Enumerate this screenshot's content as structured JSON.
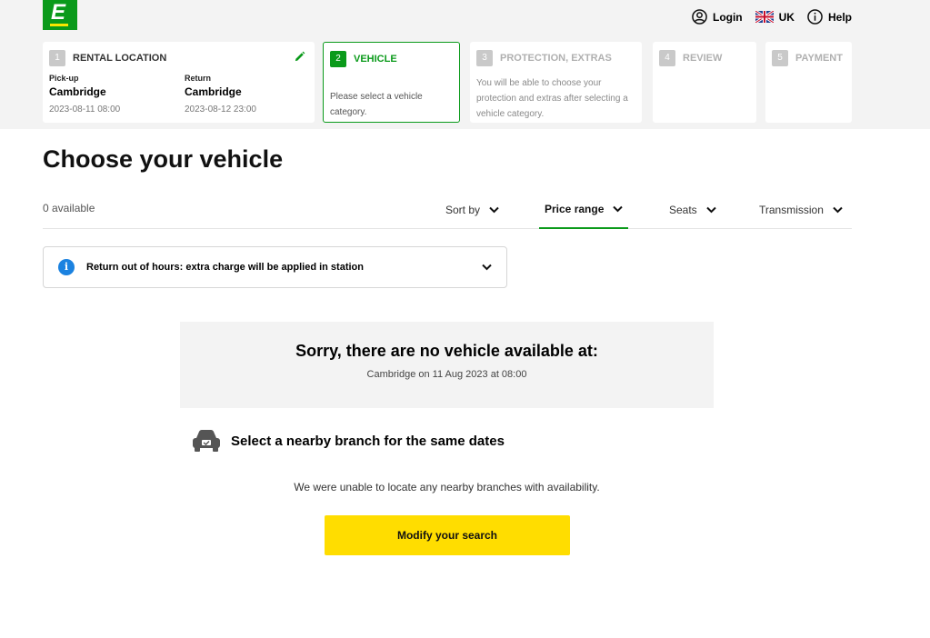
{
  "header": {
    "logo_letter": "E",
    "brand_color": "#0a9a1a",
    "accent_color": "#ffdd00",
    "login_label": "Login",
    "country_label": "UK",
    "help_label": "Help"
  },
  "steps": [
    {
      "number": "1",
      "title": "RENTAL LOCATION",
      "pickup": {
        "label": "Pick-up",
        "city": "Cambridge",
        "datetime": "2023-08-11 08:00"
      },
      "return": {
        "label": "Return",
        "city": "Cambridge",
        "datetime": "2023-08-12 23:00"
      }
    },
    {
      "number": "2",
      "title": "VEHICLE",
      "description": "Please select a vehicle category."
    },
    {
      "number": "3",
      "title": "PROTECTION, EXTRAS",
      "description": "You will be able to choose your protection and extras after selecting a vehicle category."
    },
    {
      "number": "4",
      "title": "REVIEW"
    },
    {
      "number": "5",
      "title": "PAYMENT"
    }
  ],
  "main": {
    "title": "Choose your vehicle",
    "available_text": "0 available",
    "filters": [
      {
        "label": "Sort by"
      },
      {
        "label": "Price range"
      },
      {
        "label": "Seats"
      },
      {
        "label": "Transmission"
      }
    ],
    "banner_text": "Return out of hours: extra charge will be applied in station",
    "empty_heading": "Sorry, there are no vehicle available at:",
    "empty_sub": "Cambridge on 11 Aug 2023 at 08:00",
    "nearby_heading": "Select a nearby branch for the same dates",
    "nearby_none": "We were unable to locate any nearby branches with availability.",
    "modify_button": "Modify your search"
  }
}
